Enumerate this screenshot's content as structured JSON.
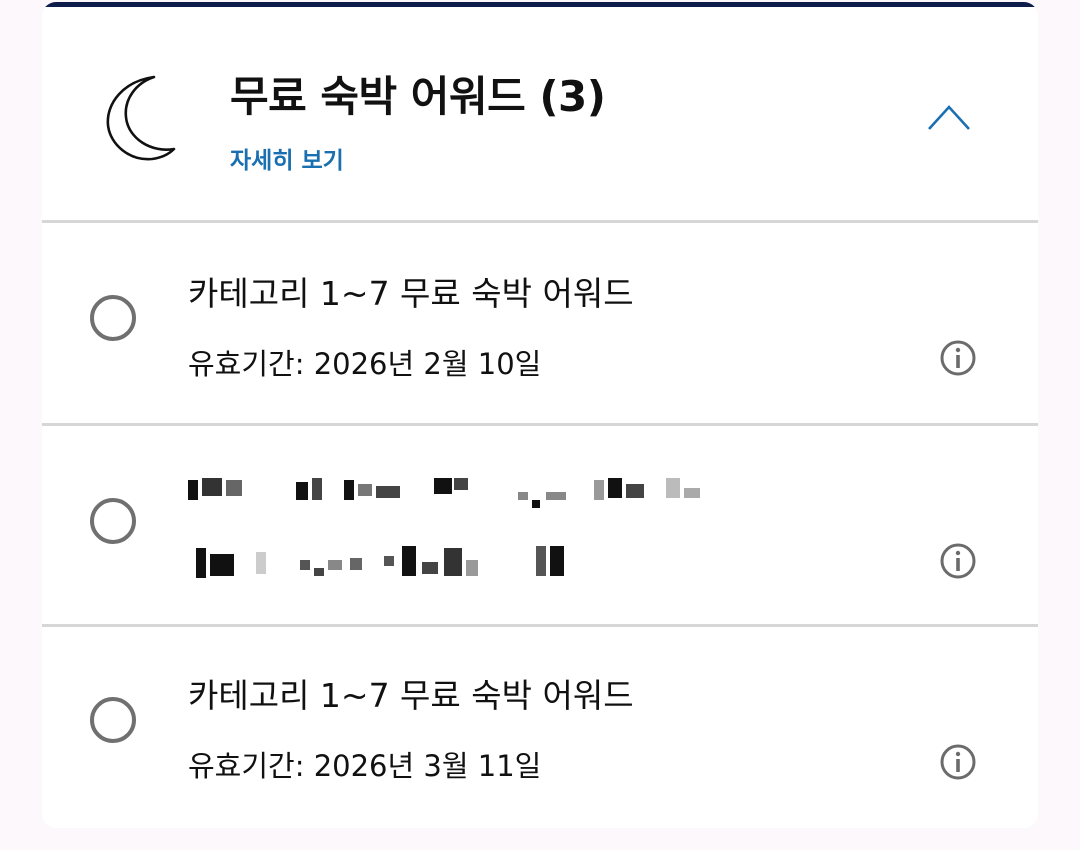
{
  "header": {
    "title": "무료 숙박 어워드 (3)",
    "details_link": "자세히 보기",
    "moon_icon": "crescent-moon-icon",
    "collapse_icon": "chevron-up-icon",
    "accent_color": "#1a6fb0",
    "topbar_color": "#0d1c4a"
  },
  "awards": [
    {
      "title": "카테고리 1~7 무료 숙박 어워드",
      "validity": "유효기간: 2026년 2월 10일",
      "redacted": false
    },
    {
      "title": "",
      "validity": "",
      "redacted": true
    },
    {
      "title": "카테고리 1~7 무료 숙박 어워드",
      "validity": "유효기간: 2026년 3월 11일",
      "redacted": false
    }
  ]
}
